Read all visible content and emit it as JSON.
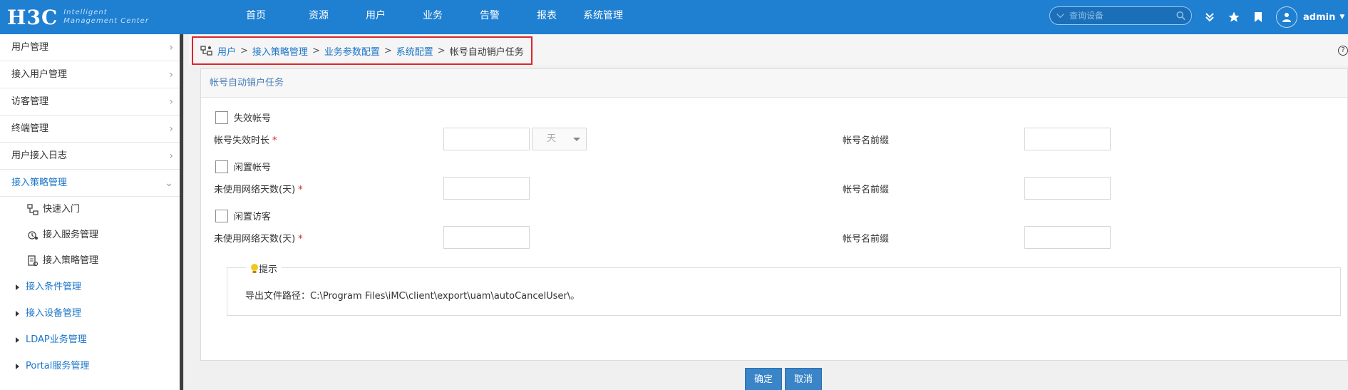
{
  "header": {
    "logo": "H3C",
    "logo_sub_line1": "Intelligent",
    "logo_sub_line2": "Management Center",
    "nav": [
      "首页",
      "资源",
      "用户",
      "业务",
      "告警",
      "报表",
      "系统管理"
    ],
    "search_placeholder": "查询设备",
    "user": "admin"
  },
  "sidebar": {
    "items": [
      "用户管理",
      "接入用户管理",
      "访客管理",
      "终端管理",
      "用户接入日志",
      "接入策略管理"
    ],
    "active_item": "接入策略管理",
    "sub_items": [
      "快速入门",
      "接入服务管理",
      "接入策略管理"
    ],
    "tree_items": [
      "接入条件管理",
      "接入设备管理",
      "LDAP业务管理",
      "Portal服务管理"
    ]
  },
  "breadcrumb": {
    "links": [
      "用户",
      "接入策略管理",
      "业务参数配置",
      "系统配置"
    ],
    "current": "帐号自动销户任务"
  },
  "panel": {
    "title": "帐号自动销户任务",
    "section1_checkbox": "失效帐号",
    "section1_field": "帐号失效时长",
    "section1_unit": "天",
    "section1_prefix": "帐号名前缀",
    "section2_checkbox": "闲置帐号",
    "section2_field": "未使用网络天数(天)",
    "section2_prefix": "帐号名前缀",
    "section3_checkbox": "闲置访客",
    "section3_field": "未使用网络天数(天)",
    "section3_prefix": "帐号名前缀",
    "required_mark": "*",
    "tip_title": "提示",
    "tip_text": "导出文件路径：C:\\Program Files\\iMC\\client\\export\\uam\\autoCancelUser\\。"
  },
  "buttons": {
    "ok": "确定",
    "cancel": "取消"
  },
  "colors": {
    "topbar": "#1f7fd1",
    "link": "#1a75c9",
    "highlight_border": "#d9262a",
    "button": "#3a84c8"
  }
}
